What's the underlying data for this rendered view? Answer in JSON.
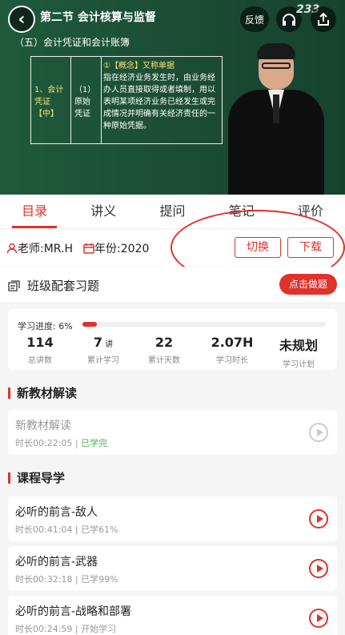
{
  "video": {
    "title": "第二节 会计核算与监督",
    "subtitle": "（五）会计凭证和会计账簿",
    "watermark": "233",
    "feedback_label": "反馈",
    "slide": {
      "col1": "1、会计凭证【中】",
      "col2": "（1）原始凭证",
      "col3_prefix": "①【概念】又称单据",
      "col3_body": "指在经济业务发生时，由业务经办人员直接取得或者填制，用以表明某项经济业务已经发生或完成情况并明确有关经济责任的一种原始凭据。"
    }
  },
  "tabs": [
    "目录",
    "讲义",
    "提问",
    "笔记",
    "评价"
  ],
  "info": {
    "teacher": "老师:MR.H",
    "year": "年份:2020",
    "switch_label": "切换",
    "download_label": "下载"
  },
  "exercise": {
    "label": "班级配套习题",
    "button": "点击做题"
  },
  "progress": {
    "label": "学习进度: 6%",
    "percent": 6,
    "stats": [
      {
        "value": "114",
        "unit": "",
        "label": "总讲数"
      },
      {
        "value": "7",
        "unit": "讲",
        "label": "累计学习"
      },
      {
        "value": "22",
        "unit": "",
        "label": "累计天数"
      },
      {
        "value": "2.07H",
        "unit": "",
        "label": "学习时长"
      },
      {
        "value": "未规划",
        "unit": "",
        "label": "学习计划"
      }
    ]
  },
  "sections": [
    {
      "title": "新教材解读"
    },
    {
      "title": "课程导学"
    }
  ],
  "lessons": [
    {
      "name": "新教材解读",
      "duration": "时长00:22:05",
      "status": "已学完"
    },
    {
      "name": "必听的前言-敌人",
      "duration": "时长00:41:04",
      "status": "已学61%"
    },
    {
      "name": "必听的前言-武器",
      "duration": "时长00:32:18",
      "status": "已学99%"
    },
    {
      "name": "必听的前言-战略和部署",
      "duration": "时长00:24:59",
      "status": "开始学习"
    }
  ],
  "colors": {
    "accent": "#e0312a",
    "done": "#4caf50"
  }
}
